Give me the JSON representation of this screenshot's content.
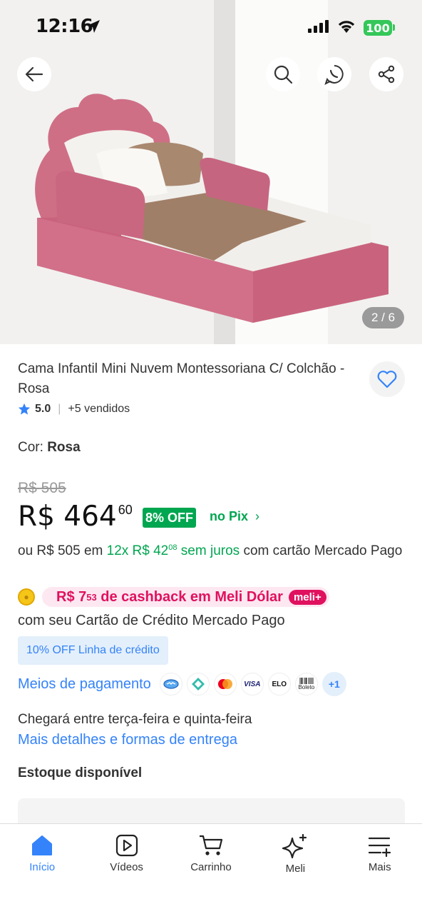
{
  "status_bar": {
    "time": "12:16",
    "battery": "100"
  },
  "gallery": {
    "counter": "2 / 6"
  },
  "product": {
    "title": "Cama Infantil  Mini Nuvem Montessoriana C/ Colchão - Rosa",
    "rating": "5.0",
    "sold": "+5 vendidos",
    "color_label": "Cor:",
    "color_value": "Rosa",
    "old_price": "R$ 505",
    "price_main": "R$ 464",
    "price_cents": "60",
    "discount": "8% OFF",
    "discount_method": "no Pix",
    "installment_prefix": "ou R$ 505 em",
    "installment_count": "12x R$ 42",
    "installment_cents": "08",
    "installment_interest": "sem juros",
    "installment_suffix": "com cartão Mercado Pago",
    "cashback_prefix": "R$ 7",
    "cashback_cents": "53",
    "cashback_text": "de cashback em Meli Dólar",
    "meli_badge": "meli+",
    "cashback_sub": "com seu Cartão de Crédito Mercado Pago",
    "credit_offer": "10% OFF Linha de crédito",
    "payment_label": "Meios de pagamento",
    "payment_more": "+1",
    "payment_icons": [
      "mercado-pago-icon",
      "pix-icon",
      "mastercard-icon",
      "visa-icon",
      "elo-icon",
      "boleto-icon"
    ],
    "payment_visa": "VISA",
    "payment_elo": "ELO",
    "payment_boleto": "Boleto",
    "shipping_text": "Chegará entre terça-feira e quinta-feira",
    "shipping_link": "Mais detalhes e formas de entrega",
    "stock_text": "Estoque disponível"
  },
  "nav": {
    "items": [
      {
        "label": "Início",
        "icon": "home-icon",
        "active": true
      },
      {
        "label": "Vídeos",
        "icon": "play-icon"
      },
      {
        "label": "Carrinho",
        "icon": "cart-icon"
      },
      {
        "label": "Meli",
        "icon": "sparkle-icon"
      },
      {
        "label": "Mais",
        "icon": "menu-plus-icon"
      }
    ]
  },
  "colors": {
    "accent": "#3483fa",
    "green": "#00a650",
    "pink": "#e0115f"
  }
}
